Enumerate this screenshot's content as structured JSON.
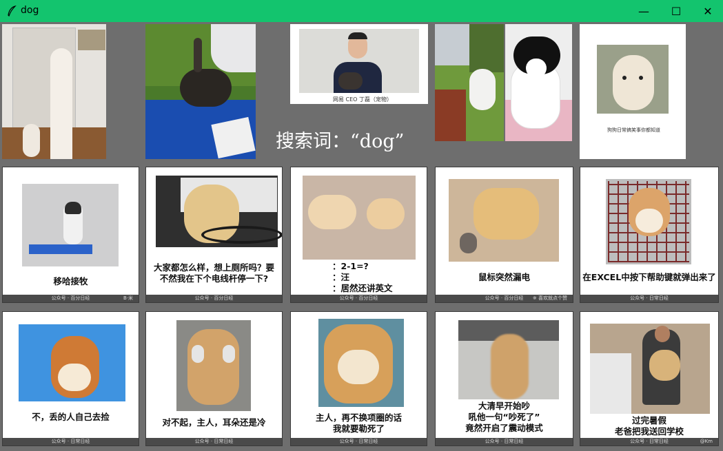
{
  "window": {
    "title": "dog",
    "minimize_glyph": "—",
    "maximize_glyph": "☐",
    "close_glyph": "✕"
  },
  "search": {
    "label": "搜索词：“dog”"
  },
  "top_images": {
    "ceo_caption": "网易 CEO 丁磊（宠物）",
    "fox_caption": "狗狗日常搞笑事你都知道"
  },
  "cards": [
    {
      "caption": "移哈接牧",
      "watermark": "公众号 · 百分日经",
      "corner": "B·米"
    },
    {
      "caption": "大家都怎么样，想上厕所吗？要\n不然我在下个电线杆停一下?",
      "watermark": "公众号 · 百分日经",
      "corner": ""
    },
    {
      "caption": "：2-1=?\n：汪\n：居然还讲英文",
      "watermark": "公众号 · 百分日经",
      "corner": ""
    },
    {
      "caption": "鼠标突然漏电",
      "watermark": "公众号 · 百分日经",
      "corner": "※ 喜欢就点个赞"
    },
    {
      "caption": "在EXCEL中按下帮助键就弹出来了",
      "watermark": "公众号 · 日常日经",
      "corner": ""
    },
    {
      "caption": "不，丢的人自己去捡",
      "watermark": "公众号 · 日常日经",
      "corner": ""
    },
    {
      "caption": "对不起，主人，耳朵还是冷",
      "watermark": "公众号 · 日常日经",
      "corner": ""
    },
    {
      "caption": "主人，再不换项圈的话\n我就要勒死了",
      "watermark": "公众号 · 日常日经",
      "corner": ""
    },
    {
      "caption": "大清早开始吵\n吼他一句“吵死了”\n竟然开启了震动模式",
      "watermark": "公众号 · 日常日经",
      "corner": ""
    },
    {
      "caption": "过完暑假\n老爸把我送回学校",
      "watermark": "公众号 · 日常日经",
      "corner": "@Km"
    }
  ],
  "colors": {
    "titlebar": "#13c46e",
    "background": "#6e6e6e"
  }
}
